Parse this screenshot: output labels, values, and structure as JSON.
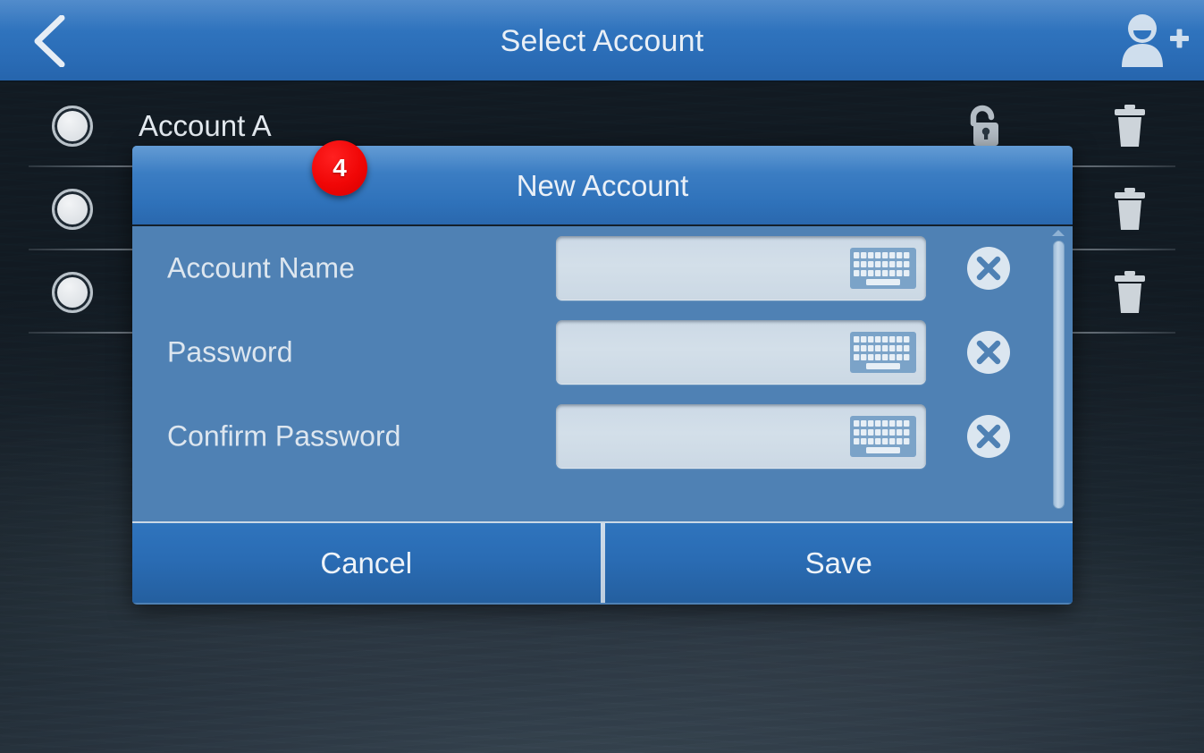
{
  "header": {
    "title": "Select Account",
    "back_icon": "chevron-left-icon",
    "add_account_icon": "add-user-icon"
  },
  "account_list": {
    "rows": [
      {
        "name": "Account A",
        "radio": "unselected",
        "lock_icon": "unlocked-padlock-icon",
        "delete_icon": "trash-icon",
        "has_lock": true,
        "has_delete": true
      },
      {
        "name": "",
        "radio": "unselected",
        "lock_icon": "",
        "delete_icon": "trash-icon",
        "has_lock": false,
        "has_delete": true
      },
      {
        "name": "",
        "radio": "unselected",
        "lock_icon": "",
        "delete_icon": "trash-icon",
        "has_lock": false,
        "has_delete": true
      }
    ]
  },
  "dialog": {
    "title": "New Account",
    "annotation_badge": "4",
    "badge_color": "#f00606",
    "fields": [
      {
        "label": "Account Name",
        "value": "",
        "placeholder": "",
        "keyboard_icon": "keyboard-icon",
        "clear_icon": "clear-circle-x-icon"
      },
      {
        "label": "Password",
        "value": "",
        "placeholder": "",
        "keyboard_icon": "keyboard-icon",
        "clear_icon": "clear-circle-x-icon"
      },
      {
        "label": "Confirm Password",
        "value": "",
        "placeholder": "",
        "keyboard_icon": "keyboard-icon",
        "clear_icon": "clear-circle-x-icon"
      }
    ],
    "cancel_label": "Cancel",
    "save_label": "Save",
    "scrollbar": {
      "up_arrow_icon": "chevron-up-icon",
      "thumb": "scroll-thumb"
    }
  },
  "colors": {
    "header_blue": "#2f73bd",
    "dialog_body_blue": "#4f81b4",
    "field_fill": "#d3dfe9",
    "backdrop_dark": "#1d2831",
    "badge_red": "#f00606"
  }
}
